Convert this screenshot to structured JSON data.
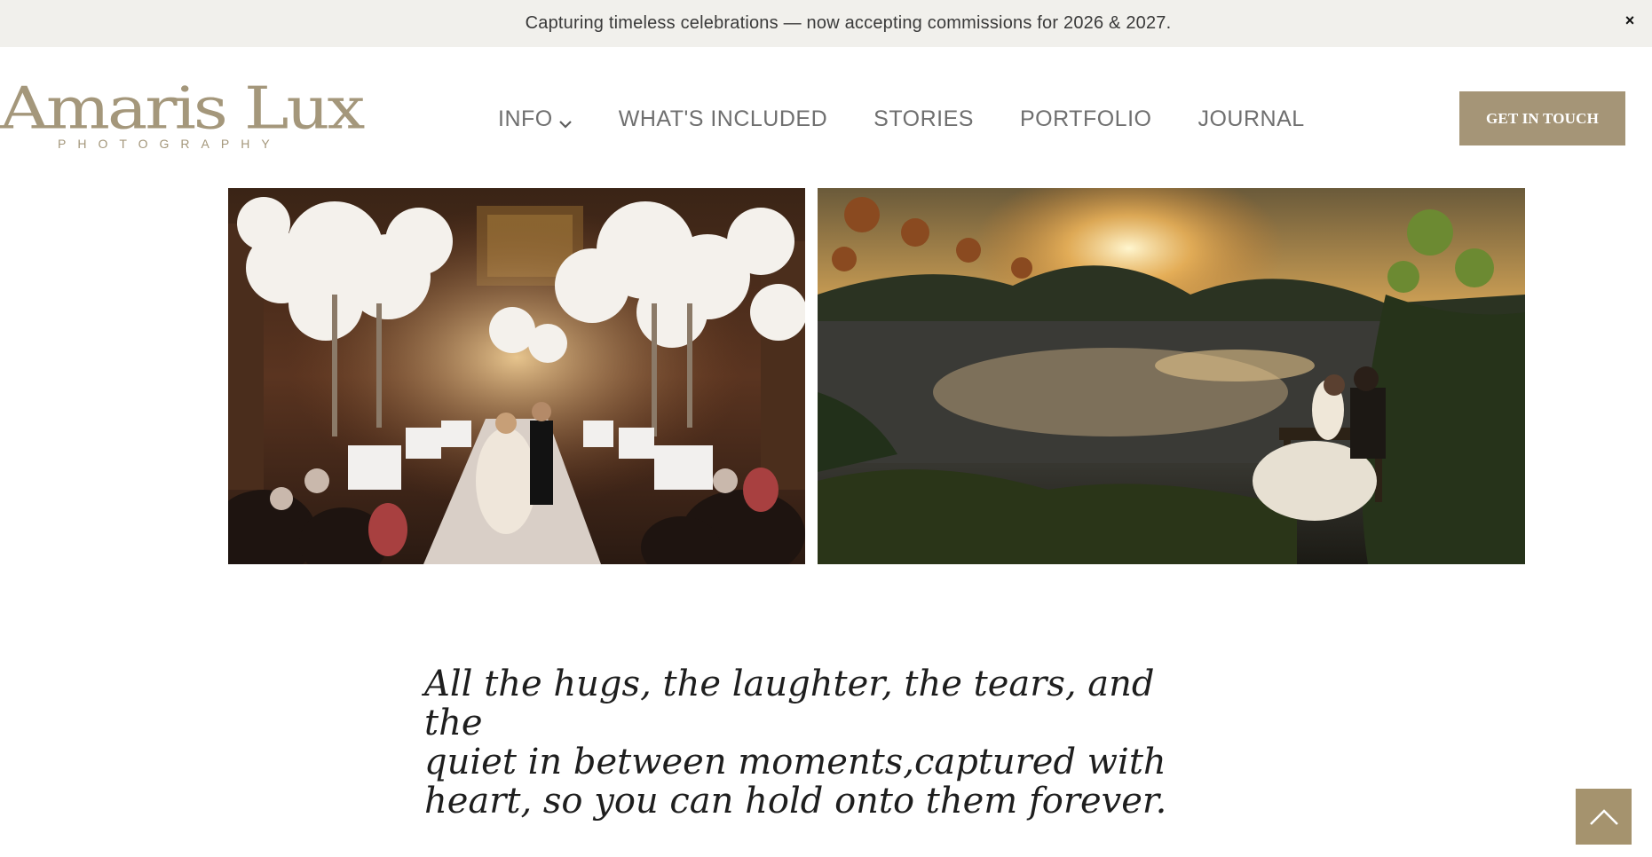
{
  "announcement": {
    "text": "Capturing timeless celebrations — now accepting commissions for 2026 & 2027.",
    "close_glyph": "×"
  },
  "brand": {
    "logo_main": "Amaris Lux",
    "logo_sub": "PHOTOGRAPHY",
    "accent_color": "#a59577"
  },
  "nav": {
    "items": [
      {
        "label": "INFO",
        "icon": "chevron-down-icon"
      },
      {
        "label": "WHAT'S INCLUDED"
      },
      {
        "label": "STORIES"
      },
      {
        "label": "PORTFOLIO"
      },
      {
        "label": "JOURNAL"
      }
    ]
  },
  "cta": {
    "label": "GET IN TOUCH"
  },
  "gallery": {
    "images": [
      "wedding-ceremony-aisle-photo",
      "sunset-lake-couple-photo"
    ]
  },
  "quote": {
    "line1": "All the hugs, the laughter, the tears, and the",
    "line2": "quiet in between moments,captured with",
    "line3": "heart, so you can hold onto them forever."
  },
  "scroll_top": {
    "icon": "chevron-up-icon"
  }
}
